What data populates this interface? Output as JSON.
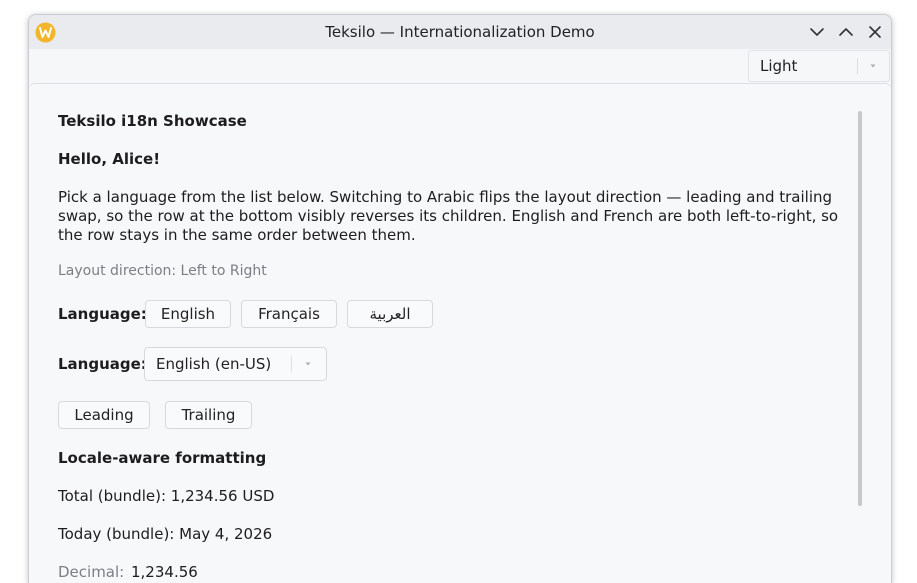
{
  "window": {
    "title": "Teksilo — Internationalization Demo"
  },
  "toolbar": {
    "theme_value": "Light"
  },
  "content": {
    "heading": "Teksilo i18n Showcase",
    "greeting": "Hello, Alice!",
    "description": "Pick a language from the list below. Switching to Arabic flips the layout direction — leading and trailing swap, so the row at the bottom visibly reverses its children. English and French are both left-to-right, so the row stays in the same order between them.",
    "layout_direction": "Layout direction: Left to Right",
    "language_label_1": "Language:",
    "language_buttons": [
      "English",
      "Français",
      "العربية"
    ],
    "language_label_2": "Language:",
    "language_select_value": "English (en-US)",
    "row_buttons": [
      "Leading",
      "Trailing"
    ],
    "formatting_heading": "Locale-aware formatting",
    "total_bundle": "Total (bundle): 1,234.56 USD",
    "today_bundle": "Today (bundle): May 4, 2026",
    "decimal_label": "Decimal:",
    "decimal_value": "1,234.56"
  }
}
